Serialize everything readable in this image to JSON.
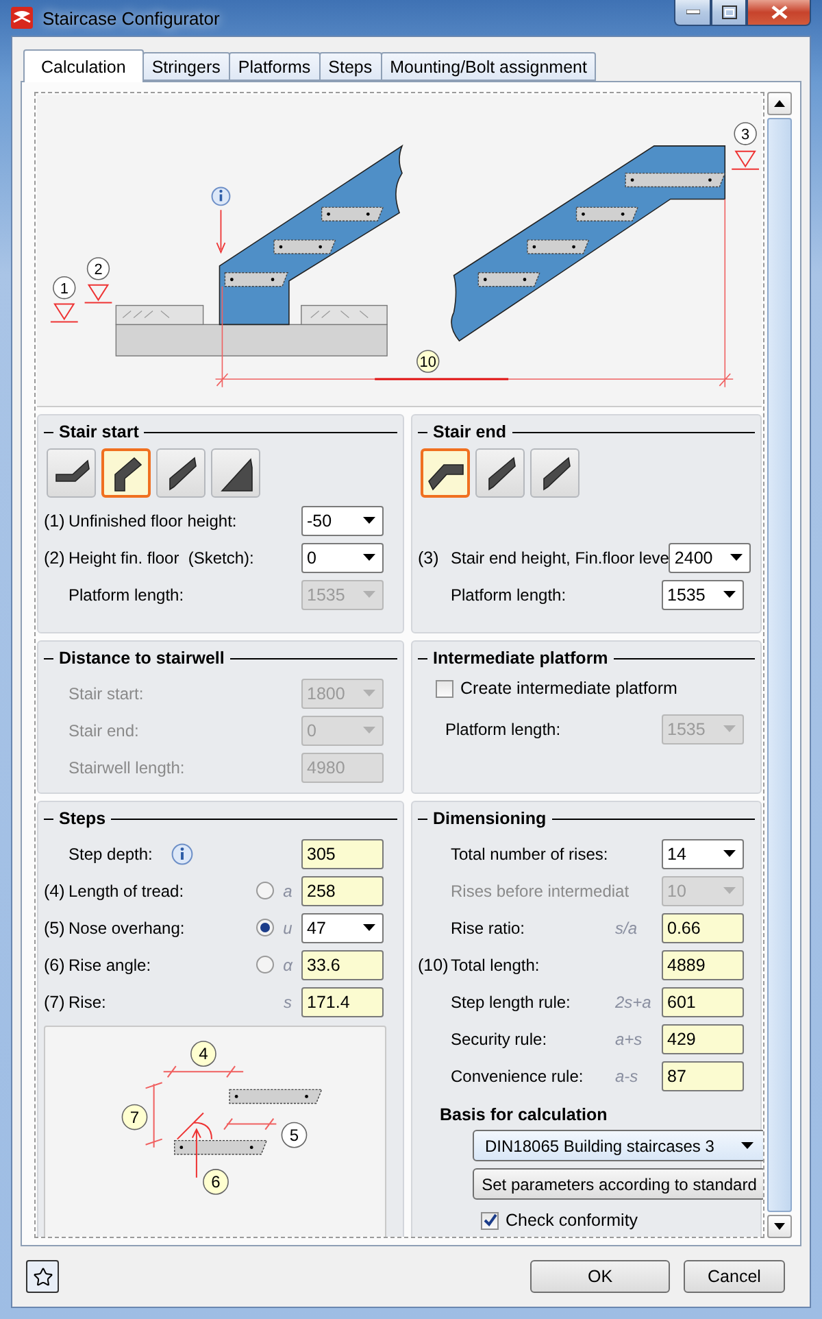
{
  "window": {
    "title": "Staircase Configurator"
  },
  "tabs": [
    {
      "label": "Calculation",
      "selected": true
    },
    {
      "label": "Stringers",
      "selected": false
    },
    {
      "label": "Platforms",
      "selected": false
    },
    {
      "label": "Steps",
      "selected": false
    },
    {
      "label": "Mounting/Bolt assignment",
      "selected": false
    }
  ],
  "sketch": {
    "callouts": [
      {
        "label": "1",
        "color": "#ffffff"
      },
      {
        "label": "2",
        "color": "#ffffff"
      },
      {
        "label": "3",
        "color": "#ffffff"
      },
      {
        "label": "10",
        "color": "#ffffd0"
      }
    ]
  },
  "stair_start": {
    "title": "Stair start",
    "types": [
      {
        "kind": "flat-start",
        "selected": false
      },
      {
        "kind": "bent",
        "selected": true
      },
      {
        "kind": "straight",
        "selected": false
      },
      {
        "kind": "wedge",
        "selected": false
      }
    ],
    "rows": [
      {
        "number": "(1)",
        "label": "Unfinished floor height:",
        "kind": "combo",
        "value": "-50"
      },
      {
        "number": "(2)",
        "label": "Height fin. floor  (Sketch):",
        "kind": "combo",
        "value": "0"
      },
      {
        "label": "Platform length:",
        "kind": "combo",
        "value": "1535",
        "disabled": true
      }
    ]
  },
  "stair_end": {
    "title": "Stair end",
    "types": [
      {
        "kind": "flat-end",
        "selected": true
      },
      {
        "kind": "straight",
        "selected": false
      },
      {
        "kind": "straight",
        "selected": false
      }
    ],
    "rows": [
      {
        "number": "(3)",
        "label": "Stair end height, Fin.floor leve",
        "kind": "combo",
        "value": "2400"
      },
      {
        "label": "Platform length:",
        "kind": "combo",
        "value": "1535"
      }
    ]
  },
  "distance": {
    "title": "Distance to stairwell",
    "rows": [
      {
        "label": "Stair start:",
        "label_greyed": true,
        "kind": "combo",
        "value": "1800",
        "disabled": true
      },
      {
        "label": "Stair end:",
        "label_greyed": true,
        "kind": "combo",
        "value": "0",
        "disabled": true
      },
      {
        "label": "Stairwell length:",
        "label_greyed": true,
        "kind": "input",
        "value": "4980",
        "disabled": true
      }
    ]
  },
  "intermediate": {
    "title": "Intermediate platform",
    "checkbox": {
      "label": "Create intermediate platform",
      "checked": false
    },
    "rows": [
      {
        "label": "Platform length:",
        "kind": "combo",
        "value": "1535",
        "disabled": true
      }
    ]
  },
  "steps": {
    "title": "Steps",
    "rows": [
      {
        "label": "Step depth:",
        "info": true,
        "kind": "input",
        "value": "305"
      },
      {
        "number": "(4)",
        "label": "Length of tread:",
        "radio": {
          "selected": false
        },
        "symbol": "a",
        "kind": "input",
        "value": "258"
      },
      {
        "number": "(5)",
        "label": "Nose overhang:",
        "radio": {
          "selected": true
        },
        "symbol": "u",
        "kind": "combo",
        "value": "47"
      },
      {
        "number": "(6)",
        "label": "Rise angle:",
        "radio": {
          "selected": false
        },
        "symbol": "α",
        "kind": "input",
        "value": "33.6"
      },
      {
        "number": "(7)",
        "label": "Rise:",
        "symbol": "s",
        "kind": "input",
        "value": "171.4"
      }
    ],
    "sketch": {
      "callouts": [
        {
          "label": "4",
          "color": "#ffffd0"
        },
        {
          "label": "7",
          "color": "#ffffd0"
        },
        {
          "label": "5",
          "color": "#ffffff"
        },
        {
          "label": "6",
          "color": "#ffffd0"
        }
      ]
    }
  },
  "dimensioning": {
    "title": "Dimensioning",
    "rows": [
      {
        "label": "Total number of rises:",
        "kind": "combo",
        "value": "14"
      },
      {
        "label": "Rises before intermediat",
        "label_greyed": true,
        "kind": "combo",
        "value": "10",
        "disabled": true
      },
      {
        "label": "Rise ratio:",
        "symbol": "s/a",
        "kind": "input",
        "value": "0.66"
      },
      {
        "number": "(10)",
        "label": "Total length:",
        "kind": "input",
        "value": "4889"
      },
      {
        "label": "Step length rule:",
        "symbol": "2s+a",
        "kind": "input",
        "value": "601"
      },
      {
        "label": "Security rule:",
        "symbol": "a+s",
        "kind": "input",
        "value": "429"
      },
      {
        "label": "Convenience rule:",
        "symbol": "a-s",
        "kind": "input",
        "value": "87"
      }
    ],
    "basis": {
      "title": "Basis for calculation",
      "standard": "DIN18065 Building staircases 3",
      "button": "Set parameters according to standard",
      "checkbox": {
        "label": "Check conformity",
        "checked": true
      }
    }
  },
  "footer": {
    "buttons": [
      "OK",
      "Cancel"
    ]
  }
}
